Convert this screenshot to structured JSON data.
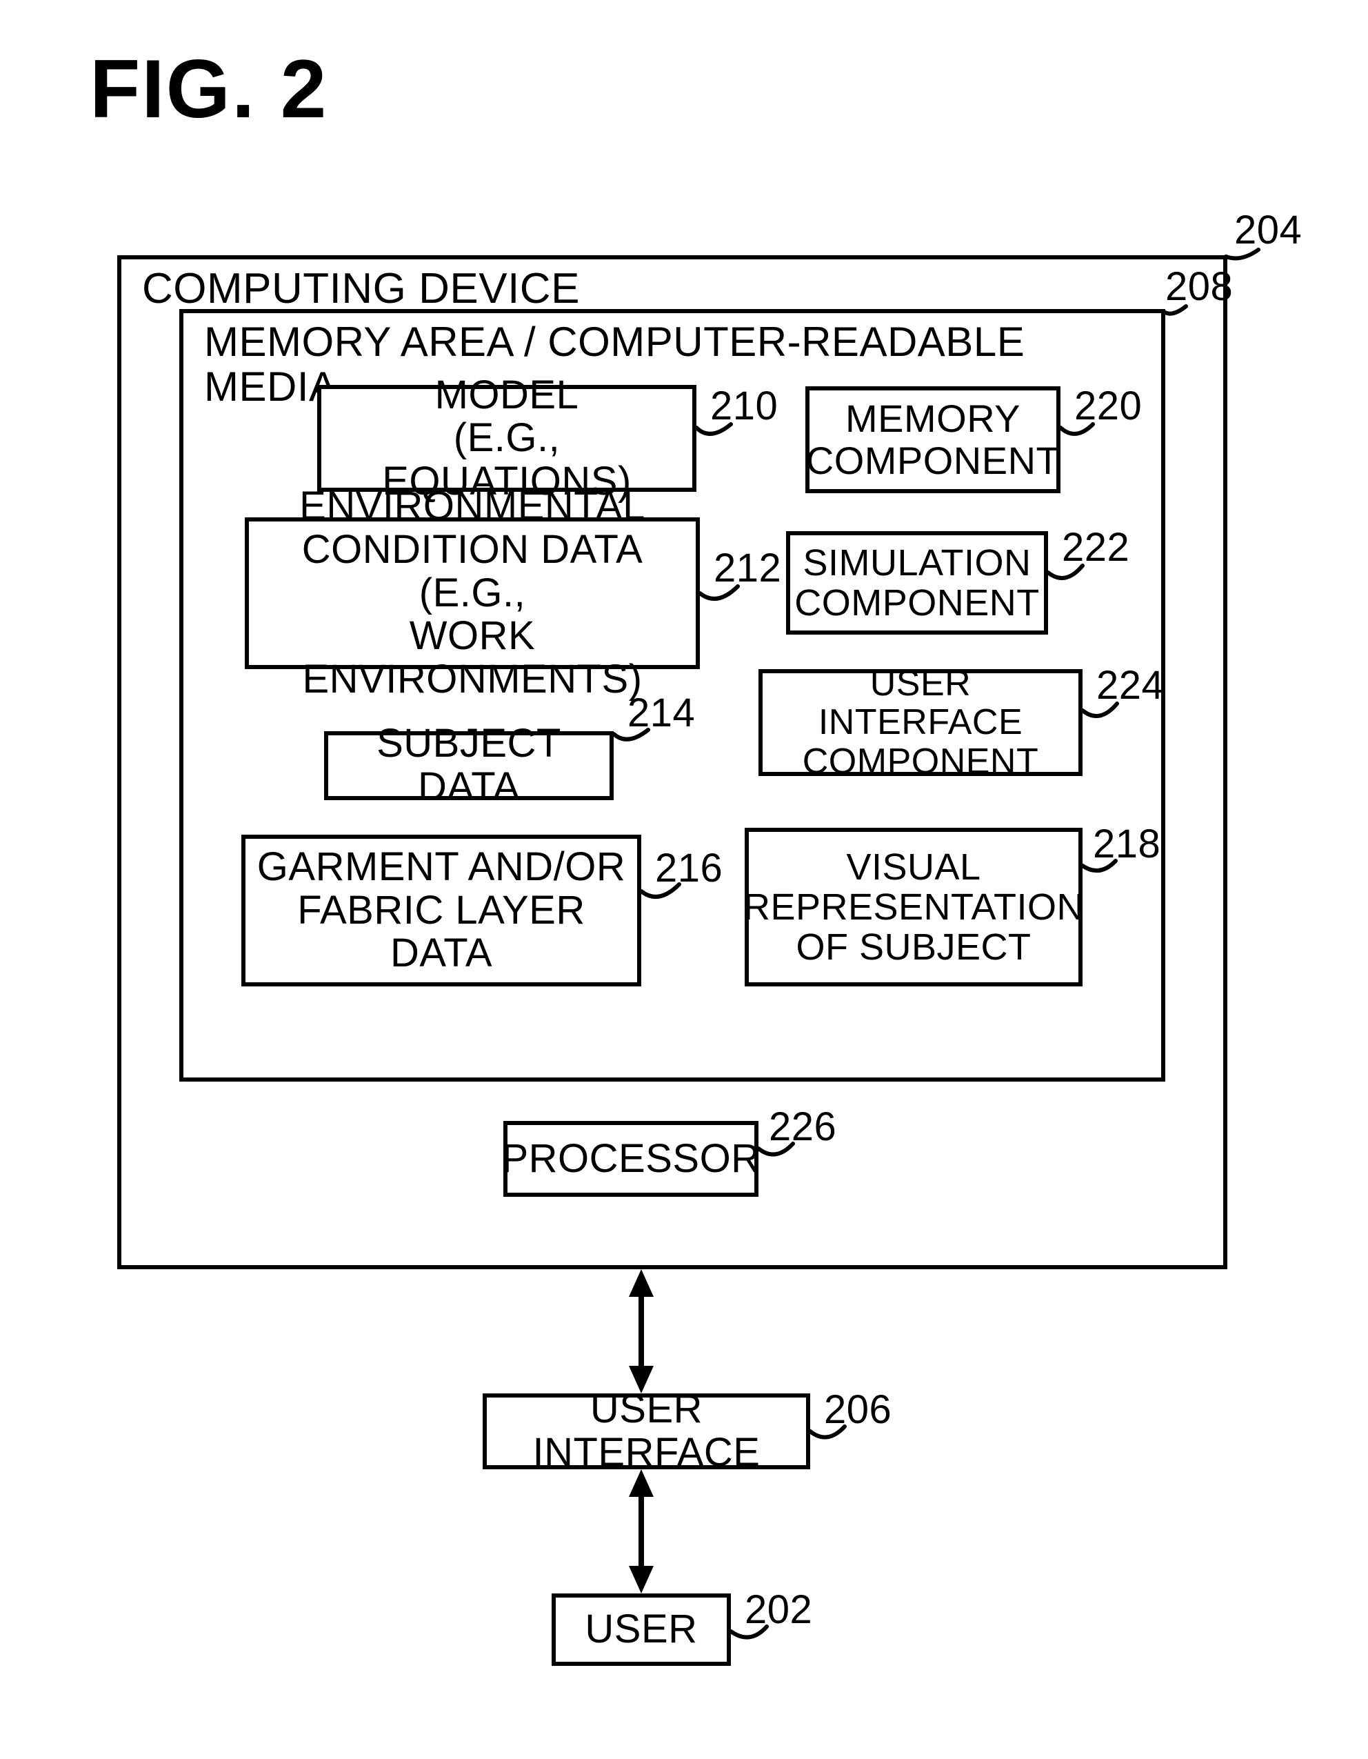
{
  "figure_label": "FIG. 2",
  "computing_device": {
    "title": "COMPUTING DEVICE",
    "ref": "204"
  },
  "memory_area": {
    "title": "MEMORY AREA / COMPUTER-READABLE MEDIA",
    "ref": "208"
  },
  "boxes": {
    "model": {
      "label": "MODEL\n(E.G., EQUATIONS)",
      "ref": "210"
    },
    "memory_comp": {
      "label": "MEMORY\nCOMPONENT",
      "ref": "220"
    },
    "env_cond": {
      "label": "ENVIRONMENTAL\nCONDITION DATA (E.G.,\nWORK ENVIRONMENTS)",
      "ref": "212"
    },
    "sim_comp": {
      "label": "SIMULATION\nCOMPONENT",
      "ref": "222"
    },
    "ui_comp": {
      "label": "USER INTERFACE\nCOMPONENT",
      "ref": "224"
    },
    "subject_data": {
      "label": "SUBJECT DATA",
      "ref": "214"
    },
    "garment": {
      "label": "GARMENT AND/OR\nFABRIC LAYER\nDATA",
      "ref": "216"
    },
    "visual_rep": {
      "label": "VISUAL\nREPRESENTATION\nOF SUBJECT",
      "ref": "218"
    },
    "processor": {
      "label": "PROCESSOR",
      "ref": "226"
    },
    "user_iface": {
      "label": "USER INTERFACE",
      "ref": "206"
    },
    "user": {
      "label": "USER",
      "ref": "202"
    }
  }
}
